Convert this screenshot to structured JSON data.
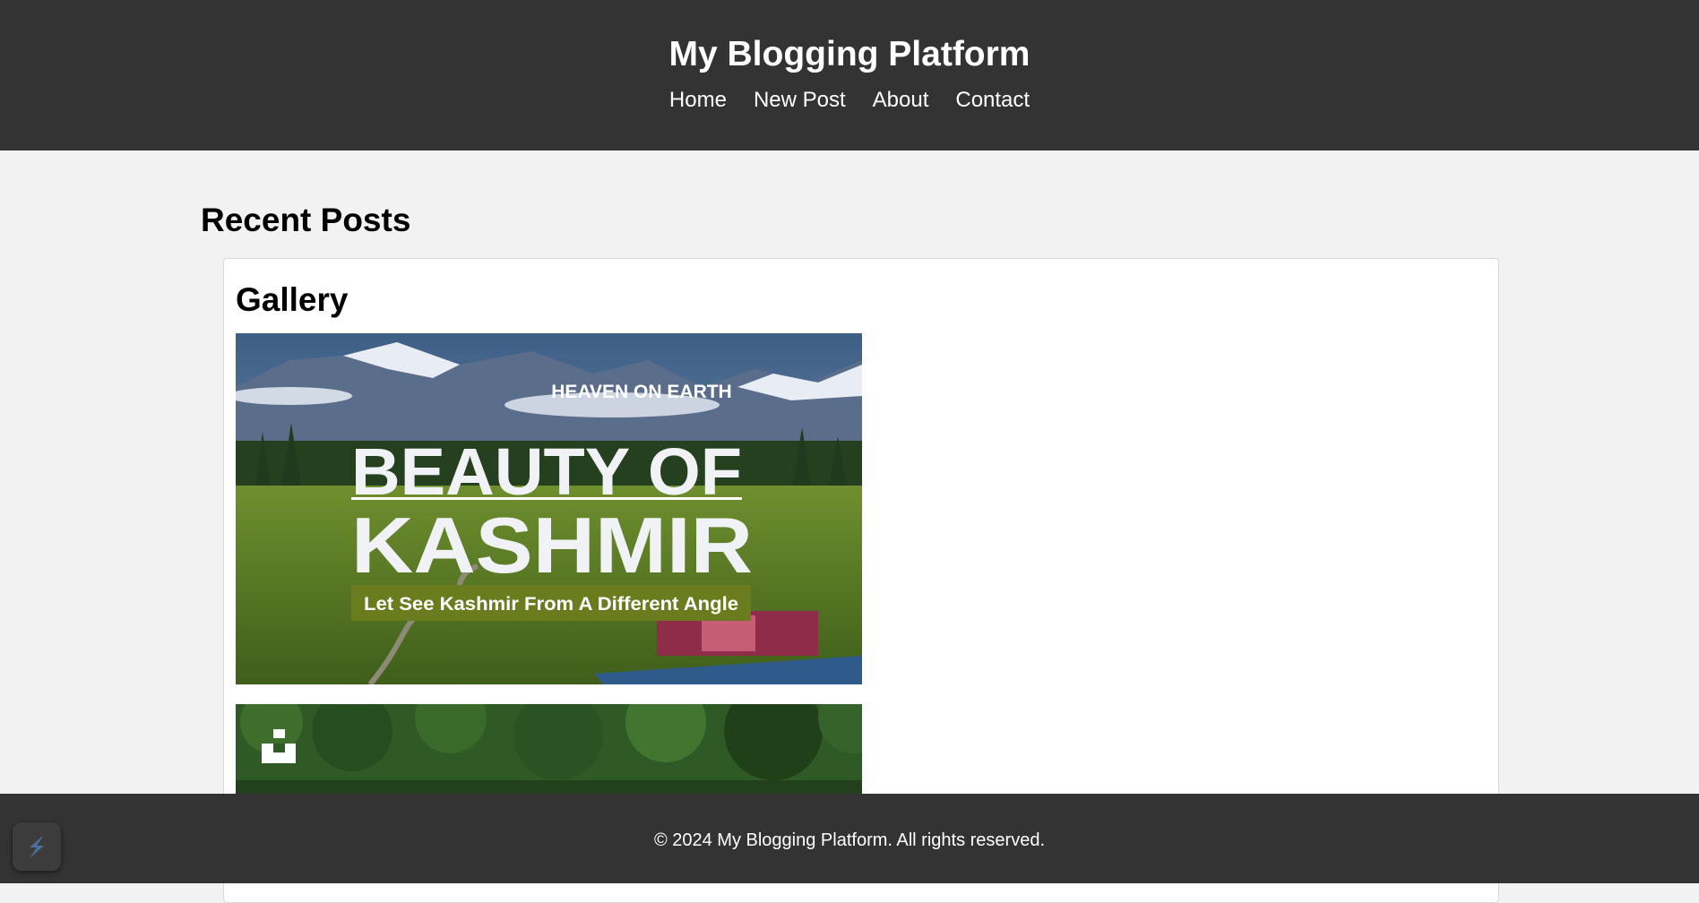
{
  "header": {
    "title": "My Blogging Platform",
    "nav": [
      "Home",
      "New Post",
      "About",
      "Contact"
    ]
  },
  "main": {
    "section_title": "Recent Posts",
    "posts": [
      {
        "title": "Gallery",
        "images": [
          {
            "alt": "Beauty of Kashmir banner",
            "overlay_top": "HEAVEN ON EARTH",
            "overlay_line1": "BEAUTY OF",
            "overlay_line2": "KASHMIR",
            "overlay_tagline": "Let See Kashmir From A Different Angle"
          },
          {
            "alt": "Forest landscape photo"
          }
        ]
      }
    ]
  },
  "footer": {
    "text": "© 2024 My Blogging Platform. All rights reserved."
  },
  "colors": {
    "header_bg": "#333333",
    "page_bg": "#f2f2f2",
    "card_bg": "#ffffff",
    "tagline_bg": "#6b7c1e"
  },
  "icons": {
    "floating_widget": "stripe-s-icon",
    "photo_watermark": "unsplash-icon"
  }
}
